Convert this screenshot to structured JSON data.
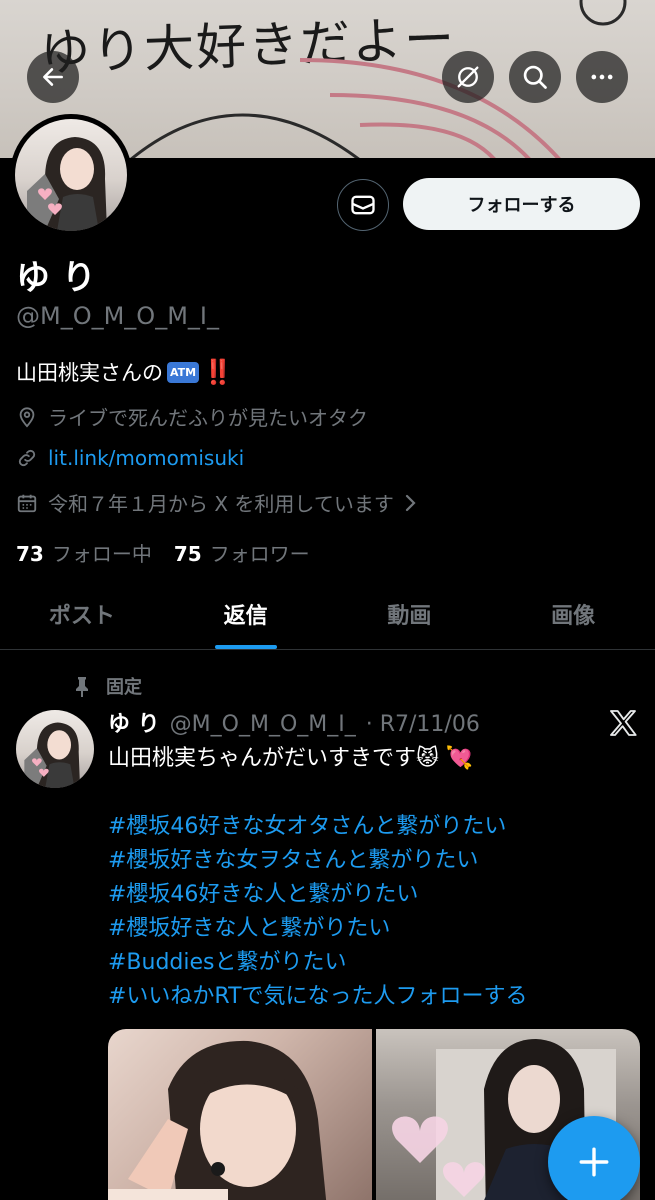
{
  "header": {
    "banner_text": "ゆり大好きだよー"
  },
  "profile": {
    "message_button_icon": "mail-icon",
    "follow_label": "フォローする",
    "name": "ゆ り",
    "handle": "@M_O_M_O_M_I_",
    "bio_text": "山田桃実さんの",
    "bio_emoji_atm": "ATM",
    "bio_emoji_bang": "‼️",
    "location": "ライブで死んだふりが見たいオタク",
    "link": "lit.link/momomisuki",
    "joined": "令和７年１月から X を利用しています",
    "following_count": "73",
    "following_label": "フォロー中",
    "followers_count": "75",
    "followers_label": "フォロワー"
  },
  "tabs": [
    {
      "label": "ポスト",
      "active": false
    },
    {
      "label": "返信",
      "active": true
    },
    {
      "label": "動画",
      "active": false
    },
    {
      "label": "画像",
      "active": false
    }
  ],
  "post": {
    "pinned_label": "固定",
    "name": "ゆ り",
    "handle": "@M_O_M_O_M_I_",
    "date": "· R7/11/06",
    "text": "山田桃実ちゃんがだいすきです😾 💘",
    "hashtags": [
      "#櫻坂46好きな女オタさんと繋がりたい",
      "#櫻坂好きな女ヲタさんと繋がりたい",
      "#櫻坂46好きな人と繋がりたい",
      "#櫻坂好きな人と繋がりたい",
      "#Buddiesと繋がりたい",
      "#いいねかRTで気になった人フォローする"
    ]
  },
  "colors": {
    "accent": "#1d9bf0",
    "background": "#000000",
    "secondary_text": "#71767b"
  }
}
